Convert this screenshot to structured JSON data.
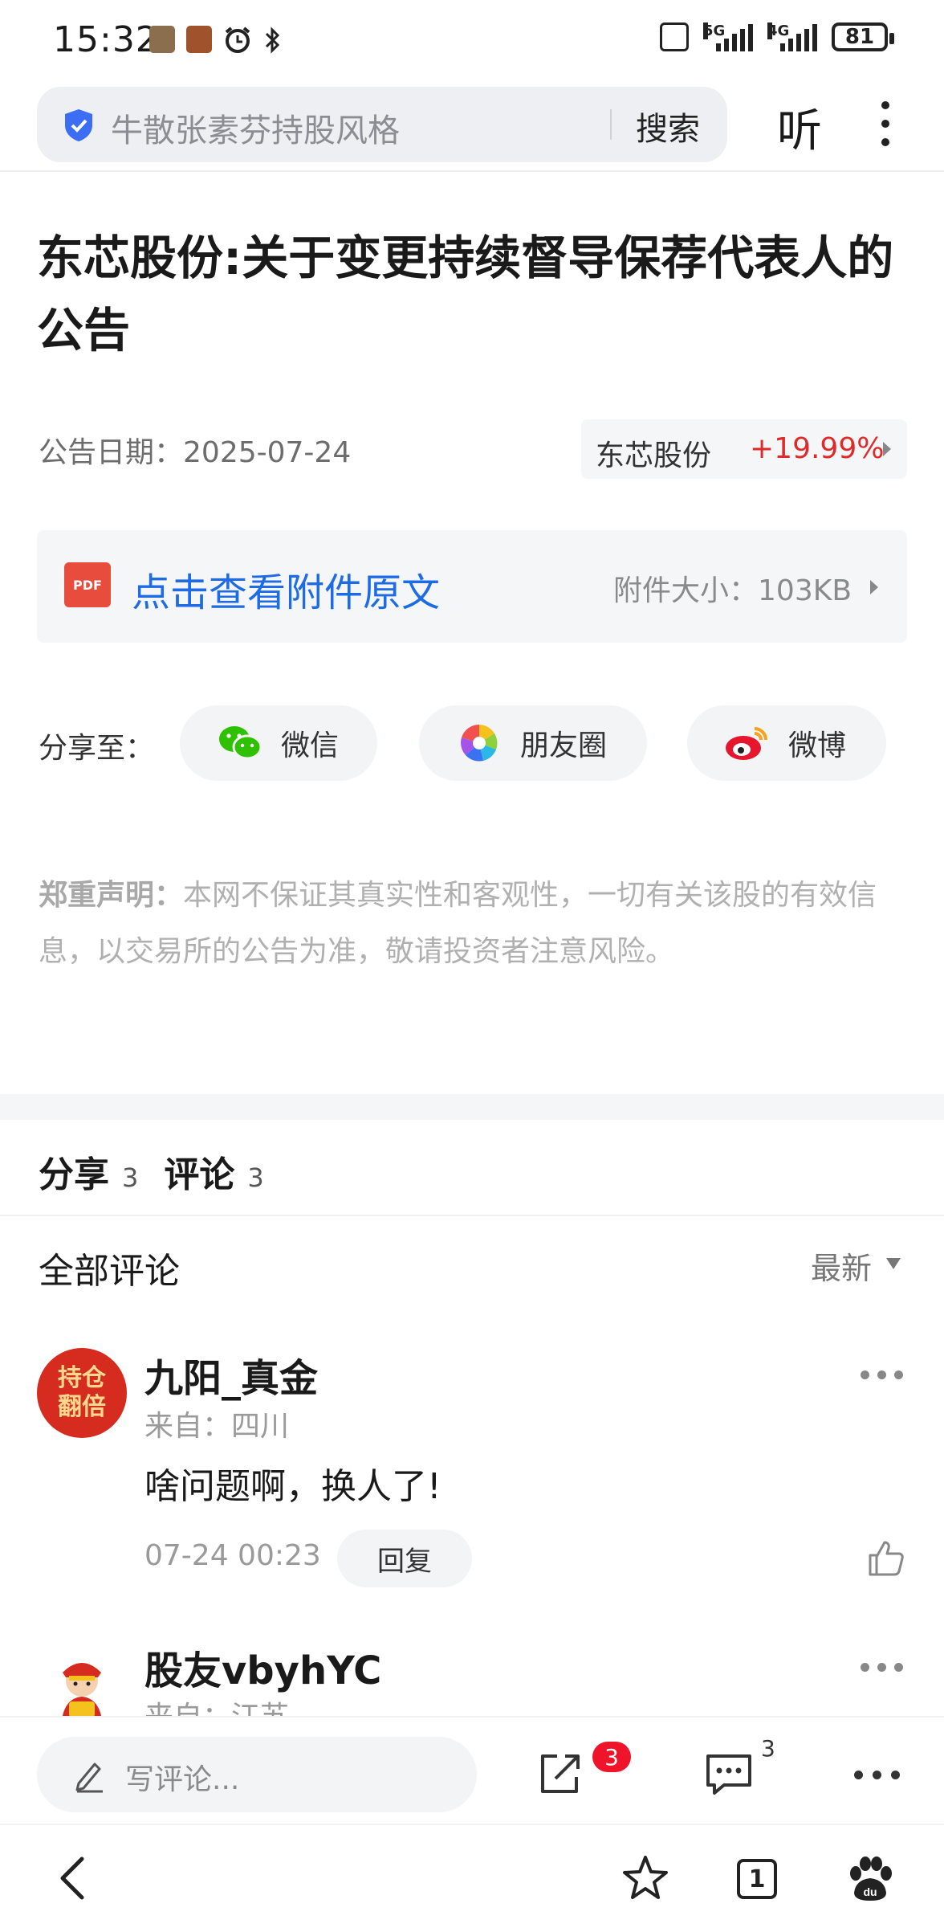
{
  "status_bar": {
    "time": "15:32",
    "network_1": "5G",
    "network_2": "4G",
    "battery": "81"
  },
  "search": {
    "query": "牛散张素芬持股风格",
    "button_label": "搜索",
    "listen_label": "听"
  },
  "article": {
    "title": "东芯股份:关于变更持续督导保荐代表人的公告",
    "date_label": "公告日期：",
    "date": "2025-07-24",
    "stock": {
      "name": "东芯股份",
      "change": "+19.99%",
      "change_color": "#e02a2a"
    },
    "attachment": {
      "icon_text": "PDF",
      "link_text": "点击查看附件原文",
      "size_label": "附件大小：",
      "size": "103KB"
    }
  },
  "share": {
    "label": "分享至：",
    "options": [
      {
        "label": "微信",
        "icon": "wechat-icon"
      },
      {
        "label": "朋友圈",
        "icon": "moments-icon"
      },
      {
        "label": "微博",
        "icon": "weibo-icon"
      }
    ]
  },
  "disclaimer": {
    "label": "郑重声明：",
    "text": "本网不保证其真实性和客观性，一切有关该股的有效信息，以交易所的公告为准，敬请投资者注意风险。"
  },
  "tabs": [
    {
      "label": "分享",
      "count": "3"
    },
    {
      "label": "评论",
      "count": "3"
    }
  ],
  "comments_header": {
    "title": "全部评论",
    "sort_label": "最新"
  },
  "comments": [
    {
      "user": "九阳_真金",
      "avatar_text_1": "持仓",
      "avatar_text_2": "翻倍",
      "from": "来自：四川",
      "text": "啥问题啊，换人了!",
      "time": "07-24 00:23",
      "reply_label": "回复"
    },
    {
      "user": "股友vbyhYC",
      "from": "来自：江苏"
    }
  ],
  "bottom_bar": {
    "write_placeholder": "写评论...",
    "share_badge": "3",
    "comment_count": "3"
  },
  "nav": {
    "tabs_count": "1"
  }
}
